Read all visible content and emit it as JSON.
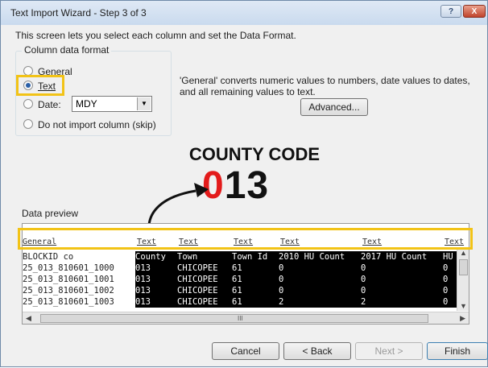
{
  "window": {
    "title": "Text Import Wizard - Step 3 of 3",
    "help_label": "?",
    "close_label": "X"
  },
  "description": "This screen lets you select each column and set the Data Format.",
  "format_group": {
    "label": "Column data format",
    "options": [
      {
        "label": "General",
        "checked": false
      },
      {
        "label": "Text",
        "checked": true
      },
      {
        "label": "Date:",
        "checked": false
      },
      {
        "label": "Do not import column (skip)",
        "checked": false
      }
    ],
    "date_format": "MDY"
  },
  "info_text": "'General' converts numeric values to numbers, date values to dates, and all remaining values to text.",
  "advanced_label": "Advanced...",
  "annotation": {
    "title": "COUNTY CODE",
    "code_highlight": "0",
    "code_rest": "13"
  },
  "preview": {
    "label": "Data preview",
    "headers": [
      "General",
      "Text",
      "Text",
      "Text",
      "Text",
      "Text",
      "Text"
    ],
    "rows": [
      [
        "BLOCKID co",
        "County",
        "Town",
        "Town Id",
        "2010 HU Count",
        "2017 HU Count",
        "HU C"
      ],
      [
        "25_013_810601_1000",
        "013",
        "CHICOPEE",
        "61",
        "0",
        "0",
        "0"
      ],
      [
        "25_013_810601_1001",
        "013",
        "CHICOPEE",
        "61",
        "0",
        "0",
        "0"
      ],
      [
        "25_013_810601_1002",
        "013",
        "CHICOPEE",
        "61",
        "0",
        "0",
        "0"
      ],
      [
        "25_013_810601_1003",
        "013",
        "CHICOPEE",
        "61",
        "2",
        "2",
        "0"
      ]
    ],
    "scroll_grip": "III"
  },
  "buttons": {
    "cancel": "Cancel",
    "back": "< Back",
    "next": "Next >",
    "finish": "Finish"
  },
  "colors": {
    "highlight": "#f2c317",
    "code_red": "#e31b1b"
  }
}
